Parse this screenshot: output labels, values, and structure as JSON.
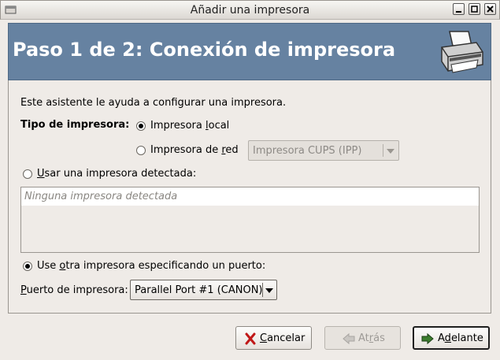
{
  "window": {
    "title": "Añadir una impresora"
  },
  "banner": {
    "heading": "Paso 1 de 2: Conexión de impresora",
    "icon": "printer-icon"
  },
  "intro": "Este asistente le ayuda a configurar una impresora.",
  "printer_type": {
    "label": "Tipo de impresora:",
    "local": {
      "pre": "Impresora ",
      "u": "l",
      "post": "ocal",
      "selected": true
    },
    "network": {
      "pre": "Impresora de ",
      "u": "r",
      "post": "ed",
      "selected": false,
      "combo_value": "Impresora CUPS (IPP)"
    }
  },
  "detected": {
    "option": {
      "pre": "",
      "u": "U",
      "post": "sar una impresora detectada:",
      "selected": false
    },
    "list_placeholder": "Ninguna impresora detectada"
  },
  "other_port": {
    "option": {
      "pre": "Use ",
      "u": "o",
      "post": "tra impresora especificando un puerto:",
      "selected": true
    },
    "port_label": {
      "pre": "",
      "u": "P",
      "post": "uerto de impresora:"
    },
    "port_value": "Parallel Port #1 (CANON)"
  },
  "buttons": {
    "cancel": {
      "pre": "",
      "u": "C",
      "post": "ancelar",
      "icon": "cancel-x-icon"
    },
    "back": {
      "pre": "At",
      "u": "r",
      "post": "ás",
      "icon": "back-arrow-icon",
      "enabled": false
    },
    "forward": {
      "pre": "A",
      "u": "d",
      "post": "elante",
      "icon": "forward-arrow-icon"
    }
  },
  "colors": {
    "banner": "#6682a1",
    "window_bg": "#efebe7"
  }
}
